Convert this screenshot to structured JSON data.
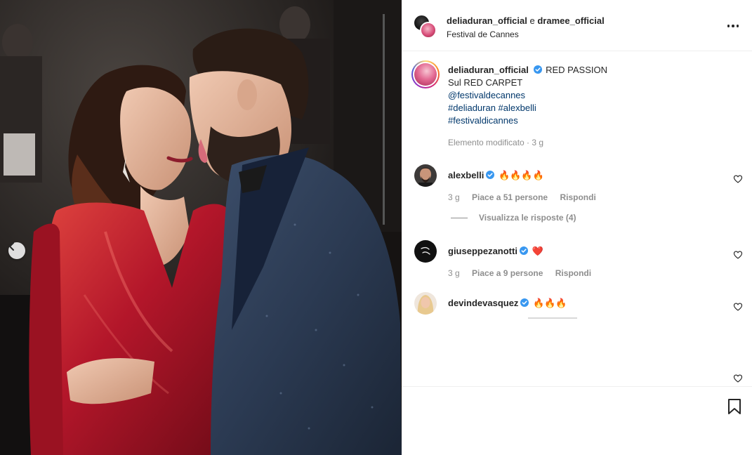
{
  "post": {
    "header": {
      "user_primary": "deliaduran_official",
      "separator": " e ",
      "user_secondary": "dramee_official",
      "location": "Festival de Cannes",
      "more_icon": "more-horizontal-icon"
    },
    "caption": {
      "username": "deliaduran_official",
      "text_first": "RED PASSION",
      "line2": "Sul RED CARPET",
      "mention": "@festivaldecannes",
      "hashtags_line1": "#deliaduran #alexbelli",
      "hashtags_line2": "#festivaldicannes",
      "meta": "Elemento modificato · 3 g"
    },
    "comments": [
      {
        "username": "alexbelli",
        "text": "🔥🔥🔥🔥",
        "time": "3 g",
        "likes": "Piace a 51 persone",
        "reply": "Rispondi",
        "view_replies": "Visualizza le risposte (4)"
      },
      {
        "username": "giuseppezanotti",
        "text": "❤️",
        "time": "3 g",
        "likes": "Piace a 9 persone",
        "reply": "Rispondi"
      },
      {
        "username": "devindevasquez",
        "text": "🔥🔥🔥"
      }
    ],
    "icons": {
      "prev": "chevron-left-icon",
      "like": "heart-outline-icon",
      "save": "bookmark-icon",
      "verified": "verified-badge-icon"
    },
    "colors": {
      "link": "#00376b",
      "verified": "#3897f0",
      "muted": "#8e8e8e",
      "dress": "#b3162a",
      "suit": "#2b3a52"
    }
  }
}
